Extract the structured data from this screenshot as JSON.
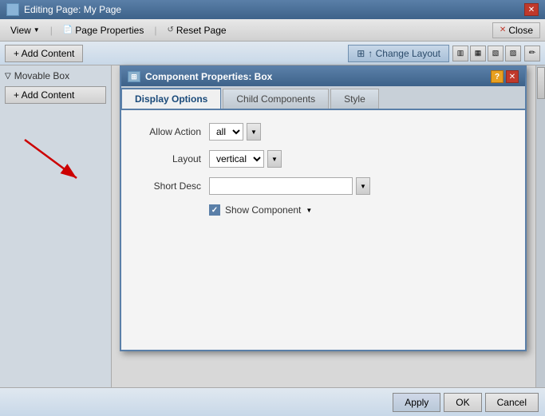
{
  "titleBar": {
    "title": "Editing Page:",
    "pageName": "My Page",
    "closeLabel": "✕"
  },
  "menuBar": {
    "viewLabel": "View",
    "pagePropsLabel": "Page Properties",
    "resetPageLabel": "Reset Page",
    "closeLabel": "Close"
  },
  "toolbar": {
    "addContentLabel": "+ Add Content",
    "changeLayoutLabel": "↑ Change Layout"
  },
  "leftPanel": {
    "movableBoxLabel": "Movable Box",
    "addContentLabel": "+ Add Content"
  },
  "dialog": {
    "title": "Component Properties: Box",
    "tabs": [
      {
        "label": "Display Options",
        "active": true
      },
      {
        "label": "Child Components",
        "active": false
      },
      {
        "label": "Style",
        "active": false
      }
    ],
    "form": {
      "allowActionLabel": "Allow Action",
      "allowActionValue": "all",
      "layoutLabel": "Layout",
      "layoutValue": "vertical",
      "shortDescLabel": "Short Desc",
      "shortDescValue": "",
      "showComponentLabel": "Show Component"
    }
  },
  "bottomBar": {
    "applyLabel": "Apply",
    "okLabel": "OK",
    "cancelLabel": "Cancel"
  },
  "icons": {
    "check": "✓",
    "arrow_down": "▼",
    "arrow_right": "▶",
    "close": "✕",
    "help": "?",
    "plus": "+",
    "expand": "▽"
  }
}
